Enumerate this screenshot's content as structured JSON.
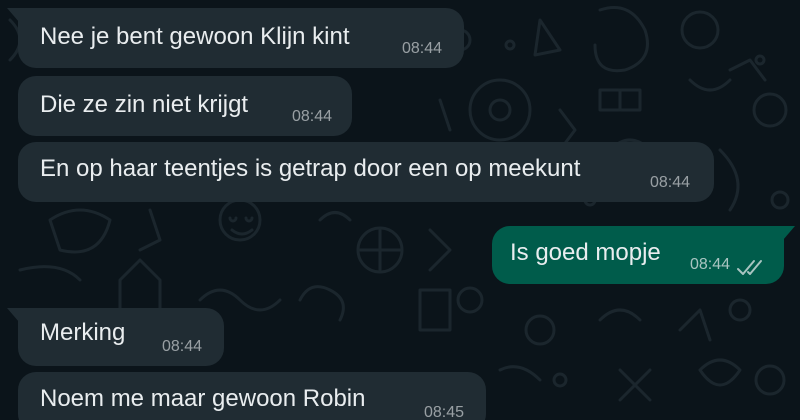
{
  "chat": {
    "messages": [
      {
        "direction": "incoming",
        "text": "Nee je bent gewoon Klijn kint",
        "time": "08:44"
      },
      {
        "direction": "incoming",
        "text": "Die ze zin niet krijgt",
        "time": "08:44"
      },
      {
        "direction": "incoming",
        "text": "En op haar teentjes is getrap door een op meekunt",
        "time": "08:44"
      },
      {
        "direction": "outgoing",
        "text": "Is goed mopje",
        "time": "08:44",
        "status_icon": "double-check-icon"
      },
      {
        "direction": "incoming",
        "text": "Merking",
        "time": "08:44"
      },
      {
        "direction": "incoming",
        "text": "Noem me maar gewoon Robin",
        "time": "08:45"
      }
    ]
  },
  "colors": {
    "background": "#0b141a",
    "incoming_bubble": "#202c33",
    "outgoing_bubble": "#005c4b",
    "text": "#e9edef",
    "doodle": "#1a252c"
  }
}
